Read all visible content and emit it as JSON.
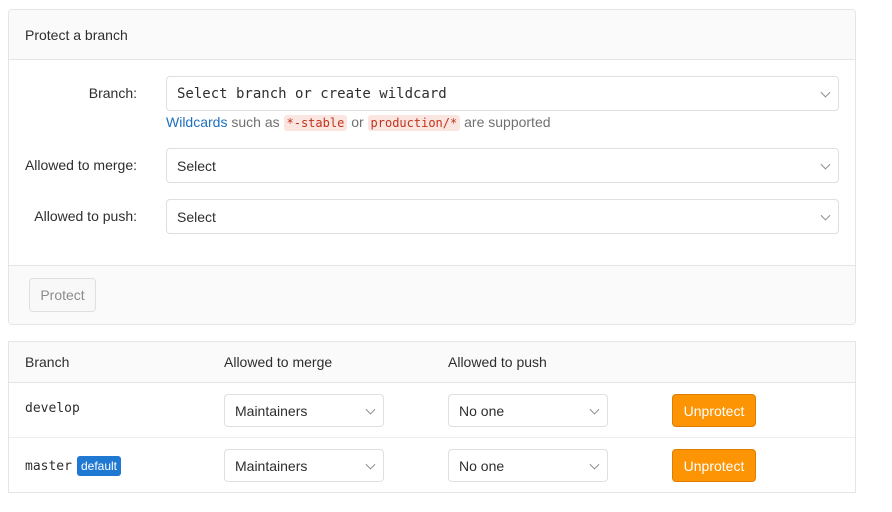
{
  "protect_form": {
    "title": "Protect a branch",
    "branch": {
      "label": "Branch:",
      "placeholder": "Select branch or create wildcard"
    },
    "help": {
      "link": "Wildcards",
      "text1": "such as",
      "code1": "*-stable",
      "text2": "or",
      "code2": "production/*",
      "text3": "are supported"
    },
    "merge": {
      "label": "Allowed to merge:",
      "value": "Select"
    },
    "push": {
      "label": "Allowed to push:",
      "value": "Select"
    },
    "submit_label": "Protect"
  },
  "table": {
    "headers": [
      "Branch",
      "Allowed to merge",
      "Allowed to push"
    ],
    "rows": [
      {
        "branch": "develop",
        "badge": "",
        "merge": "Maintainers",
        "push": "No one",
        "action": "Unprotect"
      },
      {
        "branch": "master",
        "badge": "default",
        "merge": "Maintainers",
        "push": "No one",
        "action": "Unprotect"
      }
    ]
  },
  "colors": {
    "accent_link": "#1f6fbd",
    "unprotect_button": "#fc9403",
    "default_badge": "#1f78d1"
  }
}
